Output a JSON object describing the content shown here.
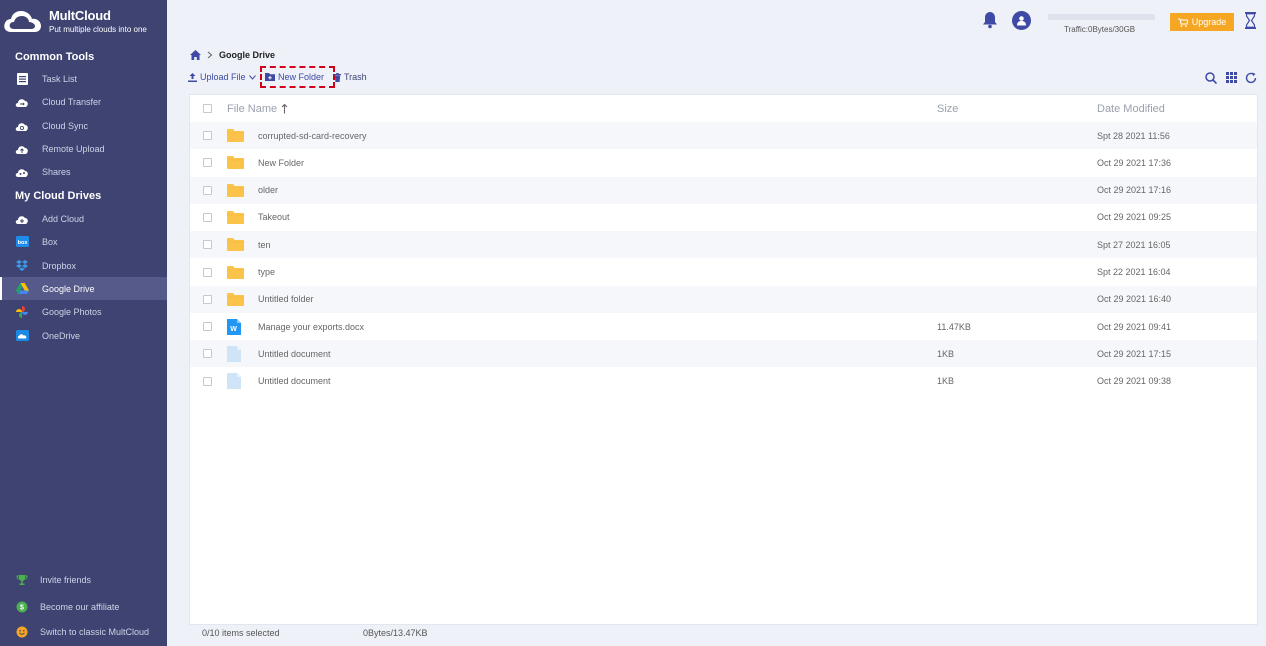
{
  "brand": {
    "name": "MultCloud",
    "tagline": "Put multiple clouds into one"
  },
  "sidebar": {
    "common_tools_title": "Common Tools",
    "common_tools": [
      {
        "label": "Task List",
        "icon": "task-list-icon"
      },
      {
        "label": "Cloud Transfer",
        "icon": "cloud-transfer-icon"
      },
      {
        "label": "Cloud Sync",
        "icon": "cloud-sync-icon"
      },
      {
        "label": "Remote Upload",
        "icon": "remote-upload-icon"
      },
      {
        "label": "Shares",
        "icon": "shares-icon"
      }
    ],
    "my_drives_title": "My Cloud Drives",
    "drives": [
      {
        "label": "Add Cloud",
        "icon": "add-cloud-icon"
      },
      {
        "label": "Box",
        "icon": "box-icon"
      },
      {
        "label": "Dropbox",
        "icon": "dropbox-icon"
      },
      {
        "label": "Google Drive",
        "icon": "google-drive-icon",
        "active": true
      },
      {
        "label": "Google Photos",
        "icon": "google-photos-icon"
      },
      {
        "label": "OneDrive",
        "icon": "onedrive-icon"
      }
    ],
    "bottom": [
      {
        "label": "Invite friends",
        "icon": "trophy-icon"
      },
      {
        "label": "Become our affiliate",
        "icon": "dollar-coin-icon"
      },
      {
        "label": "Switch to classic MultCloud",
        "icon": "smiley-icon"
      }
    ]
  },
  "topbar": {
    "traffic_text": "Traffic:0Bytes/30GB",
    "traffic_used_fraction": 0,
    "upgrade_label": "Upgrade"
  },
  "breadcrumb": {
    "current": "Google Drive"
  },
  "toolbar": {
    "upload_label": "Upload File",
    "new_folder_label": "New Folder",
    "trash_label": "Trash"
  },
  "table": {
    "headers": {
      "name": "File Name",
      "size": "Size",
      "date": "Date Modified"
    },
    "rows": [
      {
        "name": "corrupted-sd-card-recovery",
        "type": "folder",
        "size": "",
        "date": "Spt 28 2021 11:56"
      },
      {
        "name": "New Folder",
        "type": "folder",
        "size": "",
        "date": "Oct 29 2021 17:36"
      },
      {
        "name": "older",
        "type": "folder",
        "size": "",
        "date": "Oct 29 2021 17:16"
      },
      {
        "name": "Takeout",
        "type": "folder",
        "size": "",
        "date": "Oct 29 2021 09:25"
      },
      {
        "name": "ten",
        "type": "folder",
        "size": "",
        "date": "Spt 27 2021 16:05"
      },
      {
        "name": "type",
        "type": "folder",
        "size": "",
        "date": "Spt 22 2021 16:04"
      },
      {
        "name": "Untitled folder",
        "type": "folder",
        "size": "",
        "date": "Oct 29 2021 16:40"
      },
      {
        "name": "Manage your exports.docx",
        "type": "word",
        "size": "11.47KB",
        "date": "Oct 29 2021 09:41"
      },
      {
        "name": "Untitled document",
        "type": "doc",
        "size": "1KB",
        "date": "Oct 29 2021 17:15"
      },
      {
        "name": "Untitled document",
        "type": "doc",
        "size": "1KB",
        "date": "Oct 29 2021 09:38"
      }
    ]
  },
  "status": {
    "selected": "0/10 items selected",
    "size": "0Bytes/13.47KB"
  },
  "colors": {
    "sidebar": "#3e4371",
    "accent": "#3e4aa3",
    "upgrade": "#f5a623",
    "folder": "#fbc34a",
    "highlight": "#d0021b"
  }
}
